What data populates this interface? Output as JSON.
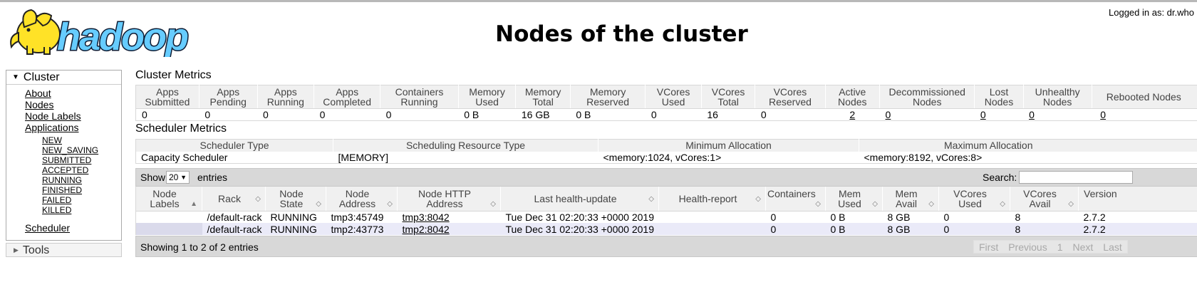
{
  "header": {
    "logo_text": "hadoop",
    "title": "Nodes of the cluster",
    "logged_in": "Logged in as: dr.who"
  },
  "sidebar": {
    "cluster_label": "Cluster",
    "links": [
      "About",
      "Nodes",
      "Node Labels",
      "Applications"
    ],
    "app_states": [
      "NEW",
      "NEW_SAVING",
      "SUBMITTED",
      "ACCEPTED",
      "RUNNING",
      "FINISHED",
      "FAILED",
      "KILLED"
    ],
    "scheduler_label": "Scheduler",
    "tools_label": "Tools"
  },
  "cluster_metrics": {
    "title": "Cluster Metrics",
    "headers": [
      "Apps Submitted",
      "Apps Pending",
      "Apps Running",
      "Apps Completed",
      "Containers Running",
      "Memory Used",
      "Memory Total",
      "Memory Reserved",
      "VCores Used",
      "VCores Total",
      "VCores Reserved",
      "Active Nodes",
      "Decommissioned Nodes",
      "Lost Nodes",
      "Unhealthy Nodes",
      "Rebooted Nodes"
    ],
    "values": [
      "0",
      "0",
      "0",
      "0",
      "0",
      "0 B",
      "16 GB",
      "0 B",
      "0",
      "16",
      "0",
      "2",
      "0",
      "0",
      "0",
      "0"
    ]
  },
  "scheduler_metrics": {
    "title": "Scheduler Metrics",
    "headers": [
      "Scheduler Type",
      "Scheduling Resource Type",
      "Minimum Allocation",
      "Maximum Allocation"
    ],
    "values": [
      "Capacity Scheduler",
      "[MEMORY]",
      "<memory:1024, vCores:1>",
      "<memory:8192, vCores:8>"
    ]
  },
  "nodes_table": {
    "show_label": "Show",
    "page_size": "20",
    "entries_label": "entries",
    "search_label": "Search:",
    "search_value": "",
    "headers": [
      "Node Labels",
      "Rack",
      "Node State",
      "Node Address",
      "Node HTTP Address",
      "Last health-update",
      "Health-report",
      "Containers",
      "Mem Used",
      "Mem Avail",
      "VCores Used",
      "VCores Avail",
      "Version"
    ],
    "rows": [
      [
        "",
        "/default-rack",
        "RUNNING",
        "tmp3:45749",
        "tmp3:8042",
        "Tue Dec 31 02:20:33 +0000 2019",
        "",
        "0",
        "0 B",
        "8 GB",
        "0",
        "8",
        "2.7.2"
      ],
      [
        "",
        "/default-rack",
        "RUNNING",
        "tmp2:43773",
        "tmp2:8042",
        "Tue Dec 31 02:20:33 +0000 2019",
        "",
        "0",
        "0 B",
        "8 GB",
        "0",
        "8",
        "2.7.2"
      ]
    ],
    "info": "Showing 1 to 2 of 2 entries",
    "pager": [
      "First",
      "Previous",
      "1",
      "Next",
      "Last"
    ]
  },
  "colors": {
    "header_bg": "#f0f0f0",
    "toolbar_bg": "#d8d8d8",
    "row_alt_bg": "#eaeaf8",
    "logo_yellow": "#ffe227",
    "logo_blue": "#66ccff"
  }
}
